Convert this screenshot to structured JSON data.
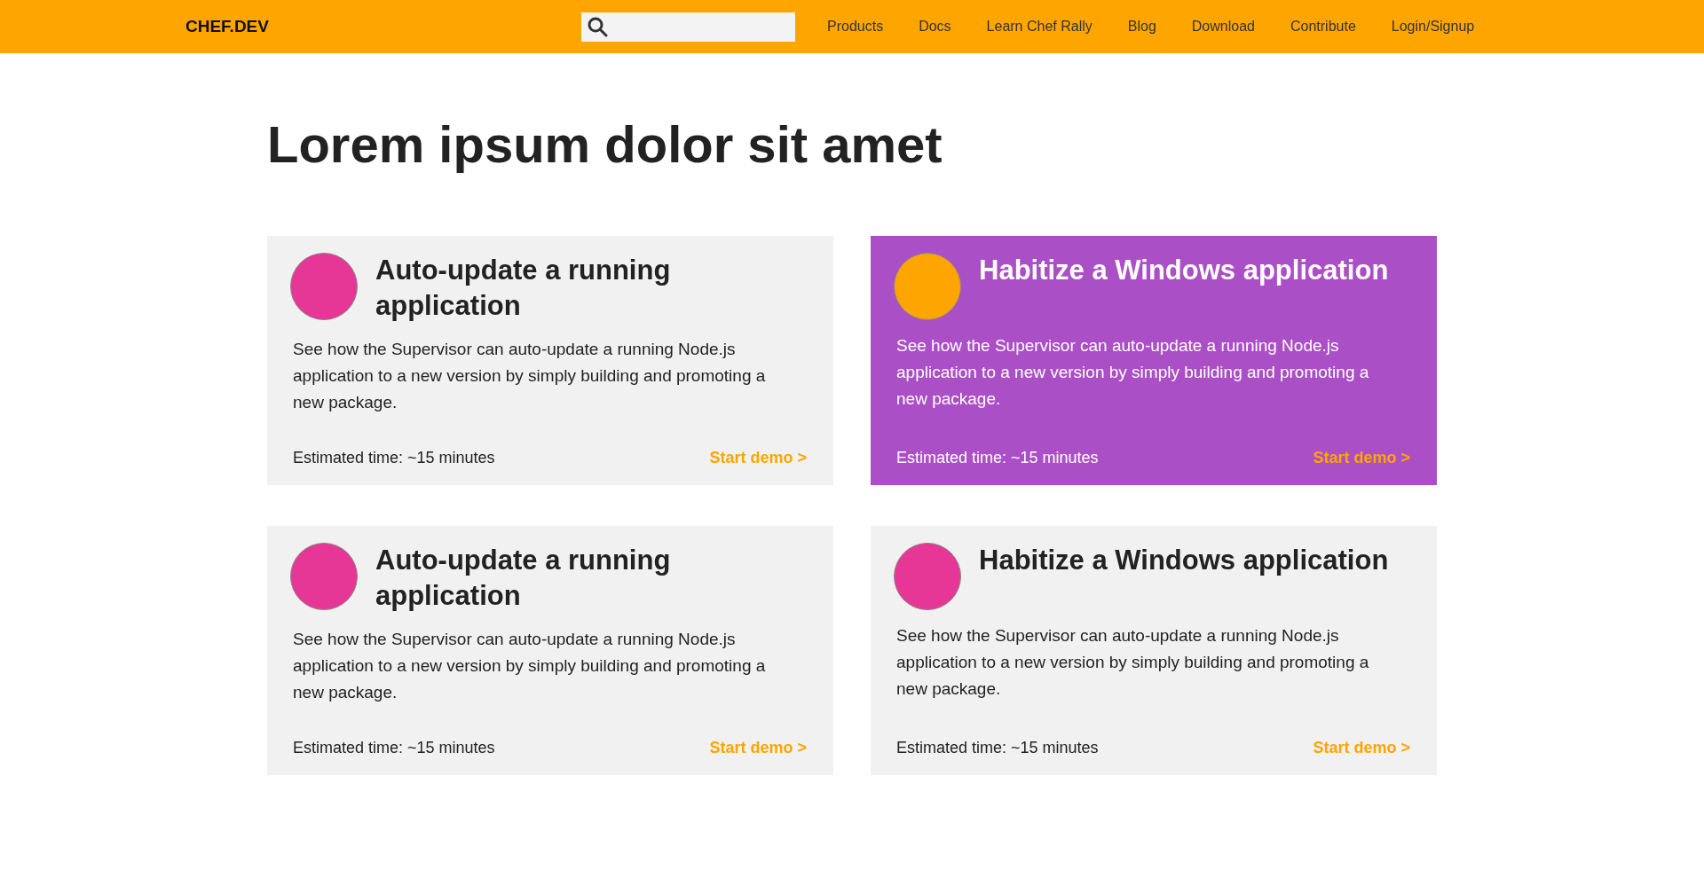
{
  "nav": {
    "logo": "CHEF.DEV",
    "links": [
      {
        "label": "Products"
      },
      {
        "label": "Docs"
      },
      {
        "label": "Learn Chef Rally"
      },
      {
        "label": "Blog"
      },
      {
        "label": "Download"
      },
      {
        "label": "Contribute"
      },
      {
        "label": "Login/Signup"
      }
    ]
  },
  "heading": "Lorem ipsum dolor sit amet",
  "cards": [
    {
      "title": "Auto-update a running application",
      "body": "See how the Supervisor can auto-update a running Node.js application to a new version by simply building and promoting a new package.",
      "time": "Estimated time: ~15 minutes",
      "link": "Start demo >",
      "selected": false
    },
    {
      "title": "Habitize a Windows application",
      "body": "See how the Supervisor can auto-update a running Node.js application to a new version by simply building and promoting a new package.",
      "time": "Estimated time: ~15 minutes",
      "link": "Start demo >",
      "selected": true
    },
    {
      "title": "Auto-update a running application",
      "body": "See how the Supervisor can auto-update a running Node.js application to a new version by simply building and promoting a new package.",
      "time": "Estimated time: ~15 minutes",
      "link": "Start demo >",
      "selected": false
    },
    {
      "title": "Habitize a Windows application",
      "body": "See how the Supervisor can auto-update a running Node.js application to a new version by simply building and promoting a new package.",
      "time": "Estimated time: ~15 minutes",
      "link": "Start demo >",
      "selected": false
    }
  ]
}
